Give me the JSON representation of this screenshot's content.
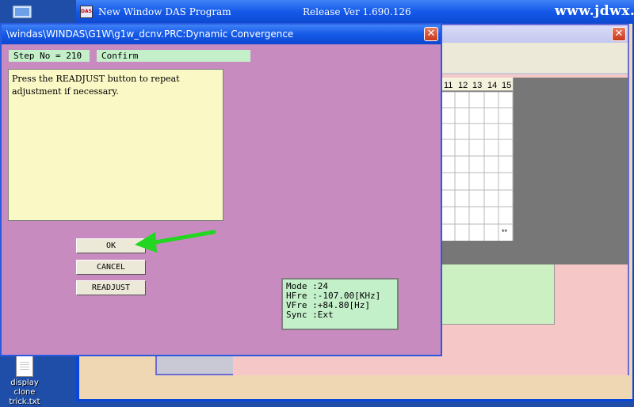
{
  "desktop": {
    "watermark": "www.jdwx.cn",
    "file_icon_label": "display clone trick.txt"
  },
  "main_window": {
    "title": "New Window DAS Program",
    "release": "Release Ver 1.690.126",
    "logo_text": "DAS"
  },
  "grid": {
    "headers": [
      "11",
      "12",
      "13",
      "14",
      "15"
    ],
    "marker": "**"
  },
  "dialog": {
    "title": "\\windas\\WINDAS\\G1W\\g1w_dcnv.PRC:Dynamic Convergence",
    "step": "Step No = 210",
    "status": "Confirm",
    "message": "Press the READJUST button to repeat adjustment if necessary.",
    "buttons": {
      "ok": "OK",
      "cancel": "CANCEL",
      "readjust": "READJUST"
    },
    "info": [
      "Mode :24",
      "HFre :-107.00[KHz]",
      "VFre :+84.80[Hz]",
      "Sync :Ext"
    ]
  },
  "colors": {
    "dialog_bg": "#c78bbf",
    "arrow": "#22d622",
    "title_blue": "#1459e8"
  },
  "icons": {
    "close": "close-icon",
    "arrow": "green-arrow-icon",
    "file": "text-file-icon",
    "desktop": "desktop-icon"
  }
}
